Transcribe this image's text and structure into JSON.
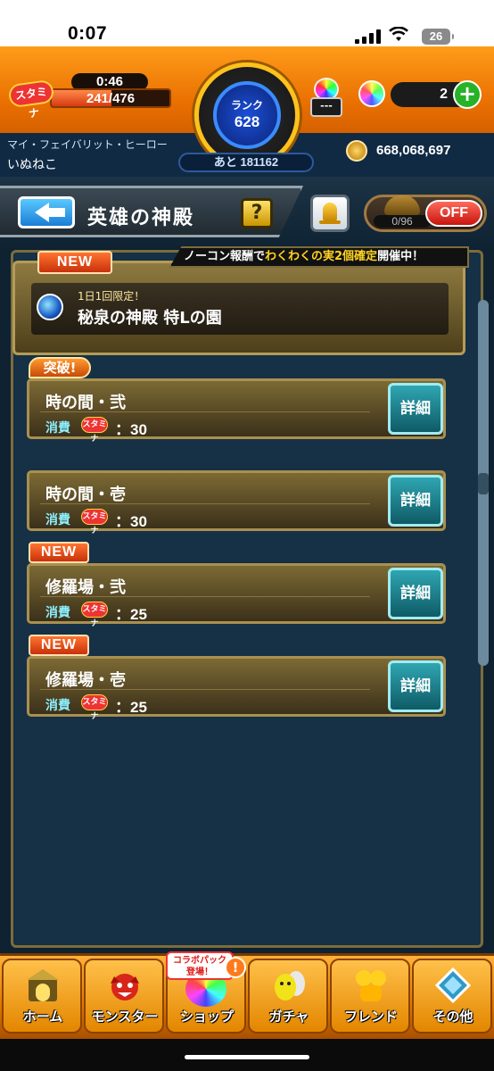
{
  "status_bar": {
    "time": "0:07",
    "battery": "26"
  },
  "header": {
    "stamina_icon": "スタミナ",
    "stamina_timer": "0:46",
    "stamina_text": "241/476",
    "stamina_fraction": 0.506,
    "rank_label": "ランク",
    "rank_value": "628",
    "next_rank": "あと 181162",
    "potion_count": "---",
    "orb_count": "2",
    "favorite_label": "マイ・フェイバリット・ヒーロー",
    "favorite_name": "いぬねこ",
    "coins": "668,068,697"
  },
  "nav": {
    "title": "英雄の神殿",
    "help": "?",
    "counter": "0/96",
    "toggle": "OFF"
  },
  "banner": {
    "new_tag": "NEW",
    "prefix": "ノーコン報酬で",
    "highlight": "わくわくの実2個確定",
    "suffix": "開催中！"
  },
  "special": {
    "subtitle": "1日1回限定！",
    "title": "秘泉の神殿 特Lの園"
  },
  "quests": [
    {
      "tag": "突破!",
      "name": "時の間・弐",
      "cost_label": "消費",
      "stamina_icon": "スタミナ",
      "cost": "：30",
      "detail": "詳細"
    },
    {
      "tag": "",
      "name": "時の間・壱",
      "cost_label": "消費",
      "stamina_icon": "スタミナ",
      "cost": "：30",
      "detail": "詳細"
    },
    {
      "tag": "NEW",
      "name": "修羅場・弐",
      "cost_label": "消費",
      "stamina_icon": "スタミナ",
      "cost": "：25",
      "detail": "詳細"
    },
    {
      "tag": "NEW",
      "name": "修羅場・壱",
      "cost_label": "消費",
      "stamina_icon": "スタミナ",
      "cost": "：25",
      "detail": "詳細"
    }
  ],
  "tabs": [
    {
      "label": "ホーム",
      "icon": "home-gate-icon"
    },
    {
      "label": "モンスター",
      "icon": "monster-icon"
    },
    {
      "label": "ショップ",
      "icon": "orb-icon",
      "badge": "コラボパック\n登場！",
      "alert": "!"
    },
    {
      "label": "ガチャ",
      "icon": "gacha-icon"
    },
    {
      "label": "フレンド",
      "icon": "friend-icon"
    },
    {
      "label": "その他",
      "icon": "other-icon"
    }
  ],
  "colors": {
    "accent": "#ff9c1a",
    "panel": "#163045",
    "detail": "#2fa6b2",
    "new": "#e4531a",
    "off": "#e02a1a"
  }
}
